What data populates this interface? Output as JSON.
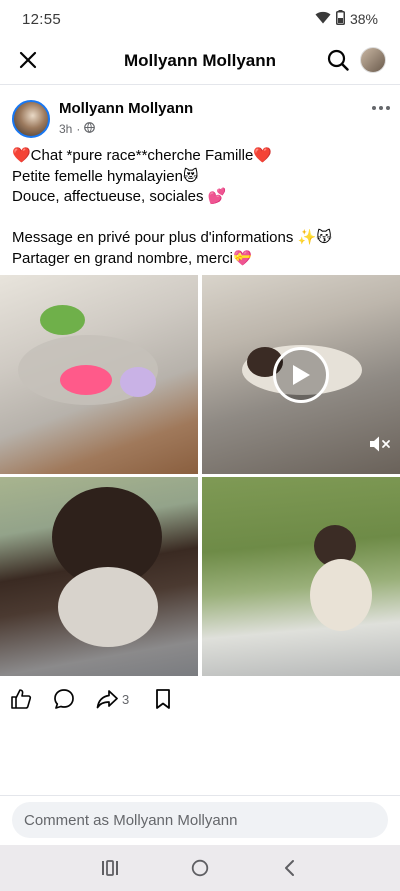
{
  "status_bar": {
    "time": "12:55",
    "battery": "38%",
    "icons": [
      "wifi-icon",
      "battery-icon"
    ]
  },
  "top_bar": {
    "title": "Mollyann Mollyann",
    "icons": [
      "close-icon",
      "search-icon",
      "avatar"
    ]
  },
  "post": {
    "author": "Mollyann Mollyann",
    "time": "3h",
    "separator": "·",
    "audience_icon": "globe-icon",
    "text_lines": [
      "❤️Chat *pure race**cherche Famille❤️",
      "Petite femelle hymalayien😻",
      "Douce, affectueuse, sociales 💕",
      "",
      "Message en privé pour plus d'informations ✨😽",
      "Partager en grand nombre, merci💝"
    ],
    "photos": [
      {
        "kind": "photo",
        "description_icon": "image"
      },
      {
        "kind": "video",
        "description_icon": "play-icon"
      },
      {
        "kind": "photo",
        "description_icon": "image"
      },
      {
        "kind": "photo",
        "description_icon": "image"
      }
    ]
  },
  "actions": {
    "share_count": "3",
    "icons": [
      "like-icon",
      "comment-icon",
      "share-icon",
      "bookmark-icon"
    ]
  },
  "comment": {
    "placeholder": "Comment as Mollyann Mollyann"
  },
  "colors": {
    "accent": "#1877f2",
    "secondary_text": "#65676b",
    "nav_bar_bg": "#eceaed",
    "comment_bg": "#f0f2f5"
  }
}
